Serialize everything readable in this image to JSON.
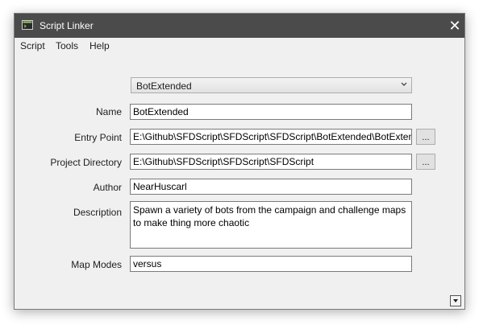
{
  "window": {
    "title": "Script Linker"
  },
  "menu": {
    "items": [
      "Script",
      "Tools",
      "Help"
    ]
  },
  "script_selector": {
    "value": "BotExtended"
  },
  "form": {
    "name": {
      "label": "Name",
      "value": "BotExtended"
    },
    "entry_point": {
      "label": "Entry Point",
      "value": "E:\\Github\\SFDScript\\SFDScript\\SFDScript\\BotExtended\\BotExtended",
      "browse": "..."
    },
    "project_directory": {
      "label": "Project Directory",
      "value": "E:\\Github\\SFDScript\\SFDScript\\SFDScript",
      "browse": "..."
    },
    "author": {
      "label": "Author",
      "value": "NearHuscarl"
    },
    "description": {
      "label": "Description",
      "value": "Spawn a variety of bots from the campaign and challenge maps to make thing more chaotic"
    },
    "map_modes": {
      "label": "Map Modes",
      "value": "versus"
    }
  },
  "icons": {
    "app": "terminal-icon",
    "close": "close-icon",
    "combo_arrow": "chevron-down-icon",
    "scroll": "arrow-down-icon"
  }
}
